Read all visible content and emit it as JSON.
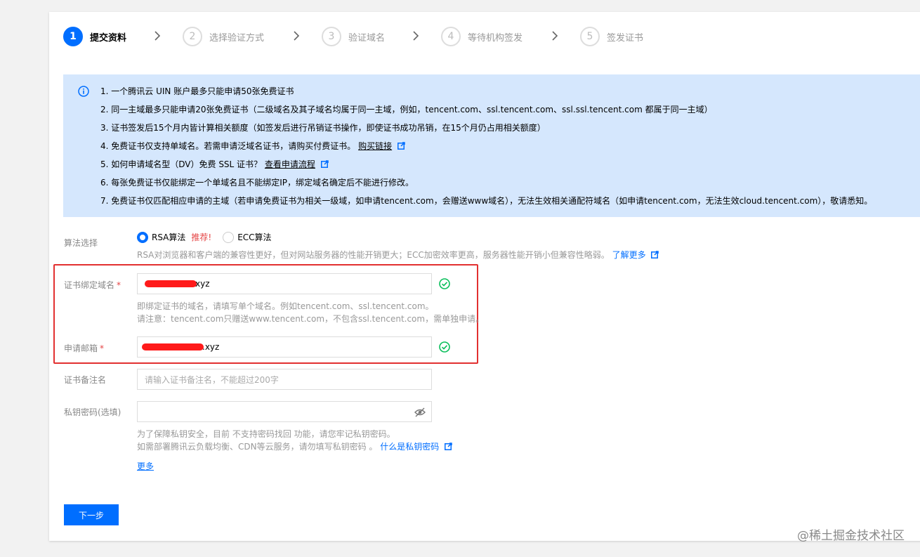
{
  "steps": [
    {
      "num": "1",
      "label": "提交资料"
    },
    {
      "num": "2",
      "label": "选择验证方式"
    },
    {
      "num": "3",
      "label": "验证域名"
    },
    {
      "num": "4",
      "label": "等待机构签发"
    },
    {
      "num": "5",
      "label": "签发证书"
    }
  ],
  "notice": {
    "items": [
      {
        "text": "1. 一个腾讯云 UIN 账户最多只能申请50张免费证书"
      },
      {
        "text": "2. 同一主域最多只能申请20张免费证书（二级域名及其子域名均属于同一主域，例如，tencent.com、ssl.tencent.com、ssl.ssl.tencent.com 都属于同一主域）"
      },
      {
        "text": "3. 证书签发后15个月内皆计算相关额度（如签发后进行吊销证书操作，即使证书成功吊销，在15个月仍占用相关额度）"
      },
      {
        "text": "4. 免费证书仅支持单域名。若需申请泛域名证书，请购买付费证书。",
        "link": "购买链接"
      },
      {
        "text": "5. 如何申请域名型（DV）免费 SSL 证书？",
        "link": "查看申请流程"
      },
      {
        "text": "6. 每张免费证书仅能绑定一个单域名且不能绑定IP，绑定域名确定后不能进行修改。"
      },
      {
        "text": "7. 免费证书仅匹配相应申请的主域（若申请免费证书为相关一级域，如申请tencent.com，会赠送www域名），无法生效相关通配符域名（如申请tencent.com，无法生效cloud.tencent.com），敬请悉知。"
      }
    ]
  },
  "algorithm": {
    "label": "算法选择",
    "rsa": "RSA算法",
    "recommend": "推荐!",
    "ecc": "ECC算法",
    "help": "RSA对浏览器和客户端的兼容性更好，但对网站服务器的性能开销更大；ECC加密效率更高，服务器性能开销小但兼容性略弱。",
    "help_link": "了解更多"
  },
  "domain": {
    "label": "证书绑定域名",
    "required": "*",
    "value": "xyz",
    "help1": "即绑定证书的域名，请填写单个域名。例如tencent.com、ssl.tencent.com。",
    "help2": "请注意：tencent.com只赠送www.tencent.com，不包含ssl.tencent.com，需单独申请。"
  },
  "email": {
    "label": "申请邮箱",
    "required": "*",
    "value": ".xyz"
  },
  "remark": {
    "label": "证书备注名",
    "placeholder": "请输入证书备注名，不能超过200字"
  },
  "privkey": {
    "label": "私钥密码(选填)",
    "help1": "为了保障私钥安全，目前 不支持密码找回 功能，请您牢记私钥密码。",
    "help2": "如需部署腾讯云负载均衡、CDN等云服务，请勿填写私钥密码 。",
    "help_link": "什么是私钥密码"
  },
  "more": "更多",
  "next_button": "下一步",
  "watermark": "@稀土掘金技术社区",
  "colors": {
    "primary": "#006eff",
    "notice_bg": "#d5e7fd",
    "success": "#0abf5b",
    "danger": "#e54545"
  }
}
